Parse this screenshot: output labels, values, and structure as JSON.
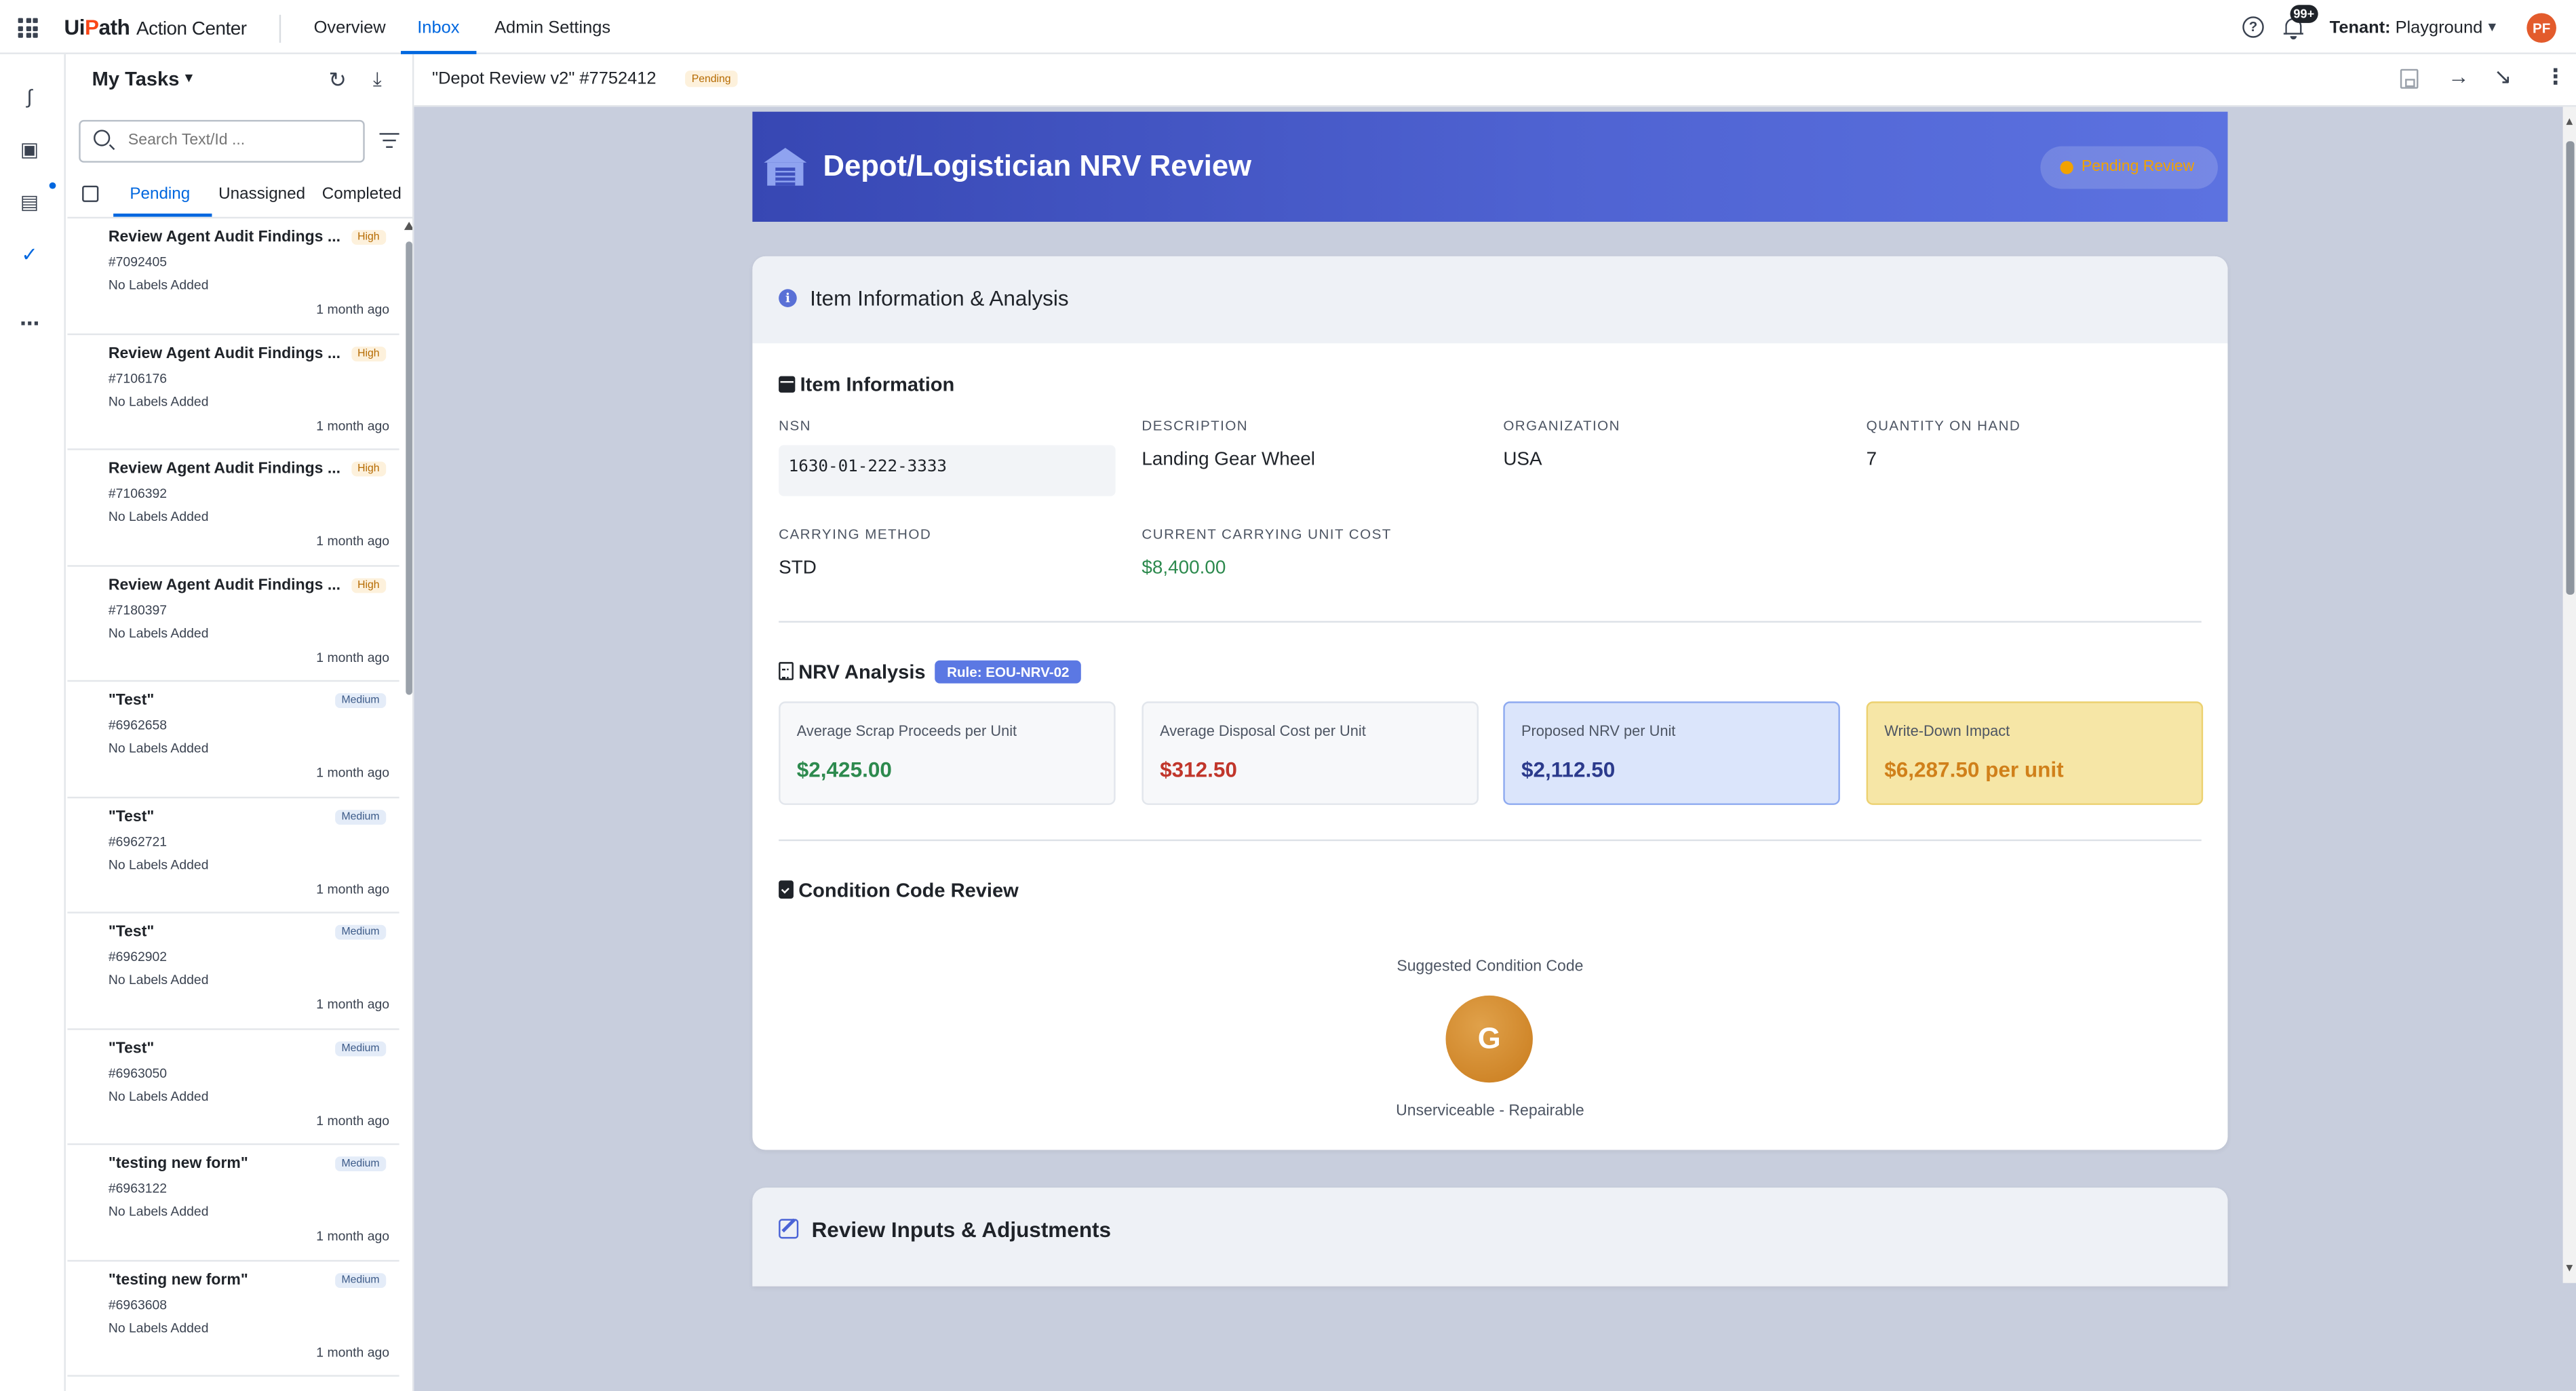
{
  "app": {
    "brand_prefix": "Ui",
    "brand_p": "P",
    "brand_suffix": "ath",
    "brand_product": "Action Center",
    "nav": [
      "Overview",
      "Inbox",
      "Admin Settings"
    ],
    "active_nav": "Inbox",
    "notifications": "99+",
    "tenant_label": "Tenant:",
    "tenant_value": "Playground",
    "avatar_initials": "PF"
  },
  "tasks_panel": {
    "title": "My Tasks",
    "search_placeholder": "Search Text/Id ...",
    "tabs": [
      "Pending",
      "Unassigned",
      "Completed"
    ],
    "active_tab": "Pending",
    "items": [
      {
        "title": "Review Agent Audit Findings ...",
        "priority": "High",
        "id": "#7092405",
        "labels": "No Labels Added",
        "time": "1 month ago"
      },
      {
        "title": "Review Agent Audit Findings ...",
        "priority": "High",
        "id": "#7106176",
        "labels": "No Labels Added",
        "time": "1 month ago"
      },
      {
        "title": "Review Agent Audit Findings ...",
        "priority": "High",
        "id": "#7106392",
        "labels": "No Labels Added",
        "time": "1 month ago"
      },
      {
        "title": "Review Agent Audit Findings ...",
        "priority": "High",
        "id": "#7180397",
        "labels": "No Labels Added",
        "time": "1 month ago"
      },
      {
        "title": "\"Test\"",
        "priority": "Medium",
        "id": "#6962658",
        "labels": "No Labels Added",
        "time": "1 month ago"
      },
      {
        "title": "\"Test\"",
        "priority": "Medium",
        "id": "#6962721",
        "labels": "No Labels Added",
        "time": "1 month ago"
      },
      {
        "title": "\"Test\"",
        "priority": "Medium",
        "id": "#6962902",
        "labels": "No Labels Added",
        "time": "1 month ago"
      },
      {
        "title": "\"Test\"",
        "priority": "Medium",
        "id": "#6963050",
        "labels": "No Labels Added",
        "time": "1 month ago"
      },
      {
        "title": "\"testing new form\"",
        "priority": "Medium",
        "id": "#6963122",
        "labels": "No Labels Added",
        "time": "1 month ago"
      },
      {
        "title": "\"testing new form\"",
        "priority": "Medium",
        "id": "#6963608",
        "labels": "No Labels Added",
        "time": "1 month ago"
      }
    ]
  },
  "task_header": {
    "name": "\"Depot Review v2\" #7752412",
    "status": "Pending"
  },
  "form": {
    "banner_title": "Depot/Logistician NRV Review",
    "banner_status": "Pending Review",
    "card1_title": "Item Information & Analysis",
    "item_info": {
      "section_title": "Item Information",
      "nsn_label": "NSN",
      "nsn_value": "1630-01-222-3333",
      "description_label": "DESCRIPTION",
      "description_value": "Landing Gear Wheel",
      "organization_label": "ORGANIZATION",
      "organization_value": "USA",
      "qoh_label": "QUANTITY ON HAND",
      "qoh_value": "7",
      "carrying_method_label": "CARRYING METHOD",
      "carrying_method_value": "STD",
      "unit_cost_label": "CURRENT CARRYING UNIT COST",
      "unit_cost_value": "$8,400.00"
    },
    "nrv": {
      "section_title": "NRV Analysis",
      "rule": "Rule: EOU-NRV-02",
      "metrics": [
        {
          "label": "Average Scrap Proceeds per Unit",
          "value": "$2,425.00"
        },
        {
          "label": "Average Disposal Cost per Unit",
          "value": "$312.50"
        },
        {
          "label": "Proposed NRV per Unit",
          "value": "$2,112.50"
        },
        {
          "label": "Write-Down Impact",
          "value": "$6,287.50 per unit"
        }
      ]
    },
    "condition": {
      "section_title": "Condition Code Review",
      "suggested_label": "Suggested Condition Code",
      "code": "G",
      "code_description": "Unserviceable - Repairable"
    },
    "card2_title": "Review Inputs & Adjustments"
  }
}
